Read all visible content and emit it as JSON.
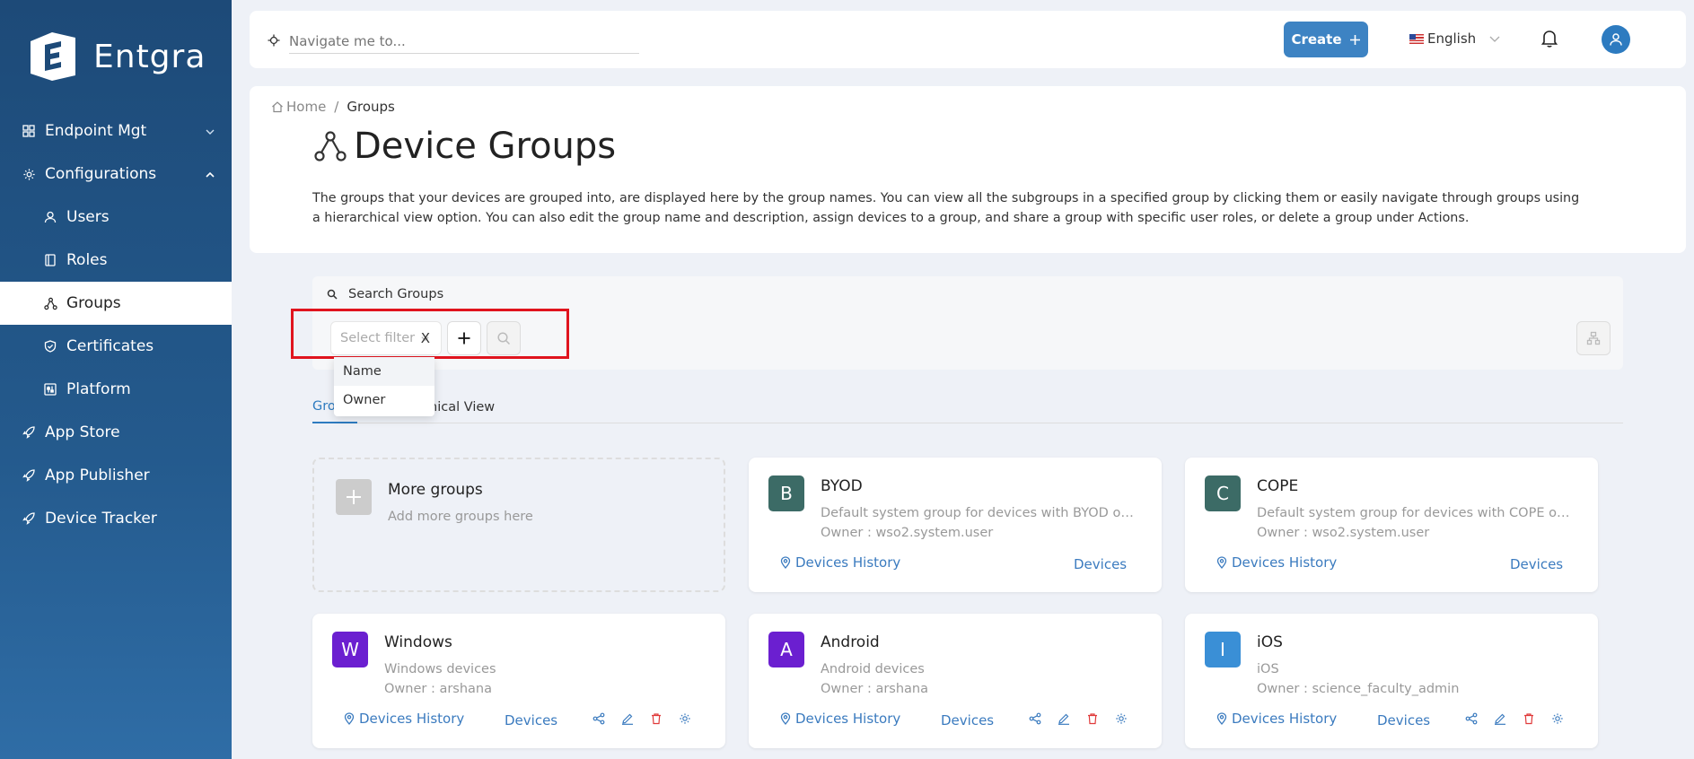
{
  "brand": {
    "name": "Entgra"
  },
  "sidebar": {
    "items": [
      {
        "label": "Endpoint Mgt",
        "icon": "grid-icon"
      },
      {
        "label": "Configurations",
        "icon": "gear-icon"
      },
      {
        "label": "Users",
        "icon": "user-icon"
      },
      {
        "label": "Roles",
        "icon": "book-icon"
      },
      {
        "label": "Groups",
        "icon": "groups-icon"
      },
      {
        "label": "Certificates",
        "icon": "shield-icon"
      },
      {
        "label": "Platform",
        "icon": "sliders-icon"
      },
      {
        "label": "App Store",
        "icon": "rocket-icon"
      },
      {
        "label": "App Publisher",
        "icon": "rocket-icon"
      },
      {
        "label": "Device Tracker",
        "icon": "rocket-icon"
      }
    ]
  },
  "topbar": {
    "nav_placeholder": "Navigate me to...",
    "create_label": "Create",
    "language": "English"
  },
  "breadcrumb": {
    "home": "Home",
    "current": "Groups"
  },
  "page": {
    "title": "Device Groups",
    "description": "The groups that your devices are grouped into, are displayed here by the group names. You can view all the subgroups in a specified group by clicking them or easily navigate through groups using a hierarchical view option. You can also edit the group name and description, assign devices to a group, and share a group with specific user roles, or delete a group under Actions."
  },
  "filter": {
    "search_label": "Search Groups",
    "select_placeholder": "Select filter",
    "clear_label": "X",
    "options": [
      "Name",
      "Owner"
    ]
  },
  "tabs": {
    "first": "Gro",
    "second": "hical View"
  },
  "more_groups": {
    "title": "More groups",
    "subtitle": "Add more groups here"
  },
  "groups": [
    {
      "initial": "B",
      "name": "BYOD",
      "description": "Default system group for devices with BYOD ownership",
      "owner": "Owner : wso2.system.user",
      "history": "Devices History",
      "devices": "Devices",
      "color": "#3c6b66"
    },
    {
      "initial": "C",
      "name": "COPE",
      "description": "Default system group for devices with COPE ownership",
      "owner": "Owner : wso2.system.user",
      "history": "Devices History",
      "devices": "Devices",
      "color": "#3c6b66"
    },
    {
      "initial": "W",
      "name": "Windows",
      "description": "Windows devices",
      "owner": "Owner : arshana",
      "history": "Devices History",
      "devices": "Devices",
      "color": "#6b1fd0"
    },
    {
      "initial": "A",
      "name": "Android",
      "description": "Android devices",
      "owner": "Owner : arshana",
      "history": "Devices History",
      "devices": "Devices",
      "color": "#6b1fd0"
    },
    {
      "initial": "I",
      "name": "iOS",
      "description": "iOS",
      "owner": "Owner : science_faculty_admin",
      "history": "Devices History",
      "devices": "Devices",
      "color": "#3a8fd6"
    }
  ]
}
